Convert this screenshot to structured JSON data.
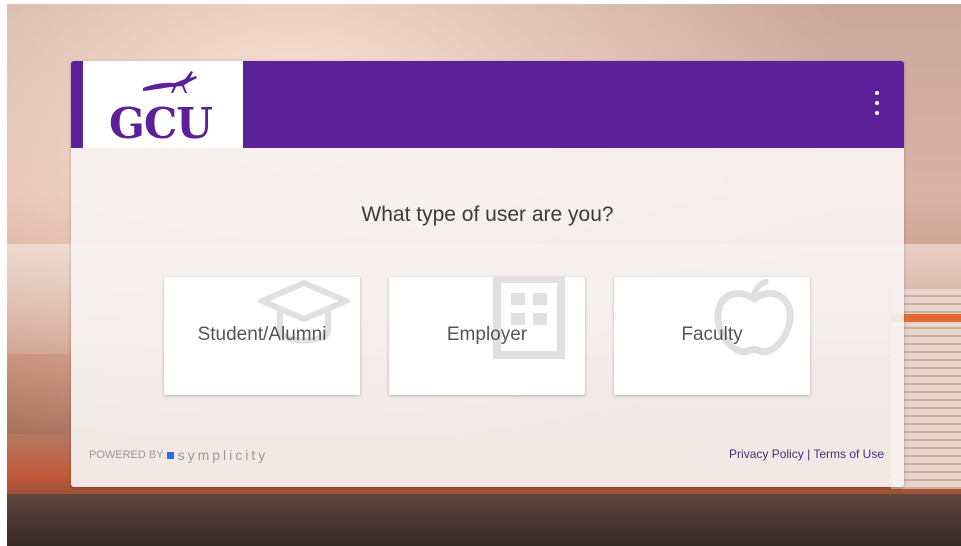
{
  "brand": {
    "logo_text": "GCU",
    "header_color": "#5c2099"
  },
  "main": {
    "question": "What type of user are you?",
    "options": [
      {
        "label": "Student/Alumni",
        "icon": "graduation-cap-icon"
      },
      {
        "label": "Employer",
        "icon": "building-icon"
      },
      {
        "label": "Faculty",
        "icon": "apple-icon"
      }
    ]
  },
  "footer": {
    "powered_by": "POWERED BY",
    "provider": "symplicity",
    "privacy": "Privacy Policy",
    "separator": "|",
    "terms": "Terms of Use"
  },
  "icons": {
    "menu": "more-vertical-icon"
  }
}
